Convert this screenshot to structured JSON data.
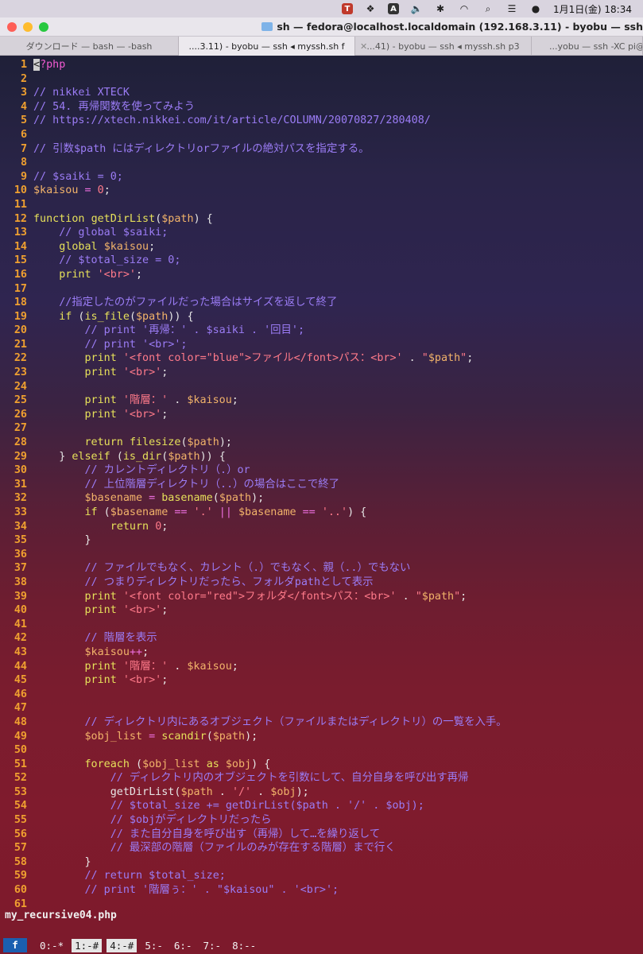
{
  "menubar": {
    "icons": [
      "brand-app-icon",
      "dropbox-icon",
      "input-a-icon",
      "volume-icon",
      "bluetooth-icon",
      "wifi-icon",
      "search-icon",
      "control-center-icon",
      "siri-icon"
    ],
    "input_label": "A",
    "clock": "1月1日(金)  18:34"
  },
  "window": {
    "title": "sh — fedora@localhost.localdomain (192.168.3.11) - byobu — ssh"
  },
  "tabs": [
    {
      "label": "ダウンロード — bash — -bash",
      "active": false
    },
    {
      "label": "....3.11) - byobu — ssh ◂ myssh.sh f",
      "active": true
    },
    {
      "label": "...41) - byobu — ssh ◂ myssh.sh p3",
      "active": false
    },
    {
      "label": "...yobu — ssh -XC pi@19",
      "active": false
    }
  ],
  "code_lines": [
    [
      [
        "cursor",
        "<"
      ],
      [
        "tag",
        "?php"
      ]
    ],
    [],
    [
      [
        "cm",
        "// nikkei XTECK"
      ]
    ],
    [
      [
        "cm",
        "// 54. 再帰関数を使ってみよう"
      ]
    ],
    [
      [
        "cm",
        "// https://xtech.nikkei.com/it/article/COLUMN/20070827/280408/"
      ]
    ],
    [],
    [
      [
        "cm",
        "// 引数$path にはディレクトリorファイルの絶対パスを指定する。"
      ]
    ],
    [],
    [
      [
        "cm",
        "// $saiki = 0;"
      ]
    ],
    [
      [
        "var",
        "$kaisou"
      ],
      [
        "op",
        " = "
      ],
      [
        "num",
        "0"
      ],
      [
        "src",
        ";"
      ]
    ],
    [],
    [
      [
        "kw",
        "function"
      ],
      [
        "src",
        " "
      ],
      [
        "fn",
        "getDirList"
      ],
      [
        "src",
        "("
      ],
      [
        "var",
        "$path"
      ],
      [
        "src",
        ") {"
      ]
    ],
    [
      [
        "src",
        "    "
      ],
      [
        "cm",
        "// global $saiki;"
      ]
    ],
    [
      [
        "src",
        "    "
      ],
      [
        "kw",
        "global"
      ],
      [
        "src",
        " "
      ],
      [
        "var",
        "$kaisou"
      ],
      [
        "src",
        ";"
      ]
    ],
    [
      [
        "src",
        "    "
      ],
      [
        "cm",
        "// $total_size = 0;"
      ]
    ],
    [
      [
        "src",
        "    "
      ],
      [
        "kw",
        "print"
      ],
      [
        "src",
        " "
      ],
      [
        "str",
        "'<br>'"
      ],
      [
        "src",
        ";"
      ]
    ],
    [],
    [
      [
        "src",
        "    "
      ],
      [
        "cm",
        "//指定したのがファイルだった場合はサイズを返して終了"
      ]
    ],
    [
      [
        "src",
        "    "
      ],
      [
        "kw",
        "if"
      ],
      [
        "src",
        " ("
      ],
      [
        "fn",
        "is_file"
      ],
      [
        "src",
        "("
      ],
      [
        "var",
        "$path"
      ],
      [
        "src",
        ")) {"
      ]
    ],
    [
      [
        "src",
        "        "
      ],
      [
        "cm",
        "// print '再帰：' . $saiki . '回目';"
      ]
    ],
    [
      [
        "src",
        "        "
      ],
      [
        "cm",
        "// print '<br>';"
      ]
    ],
    [
      [
        "src",
        "        "
      ],
      [
        "kw",
        "print"
      ],
      [
        "src",
        " "
      ],
      [
        "str",
        "'<font color=\"blue\">ファイル</font>パス：<br>'"
      ],
      [
        "src",
        " . "
      ],
      [
        "str",
        "\""
      ],
      [
        "var",
        "$path"
      ],
      [
        "str",
        "\""
      ],
      [
        "src",
        ";"
      ]
    ],
    [
      [
        "src",
        "        "
      ],
      [
        "kw",
        "print"
      ],
      [
        "src",
        " "
      ],
      [
        "str",
        "'<br>'"
      ],
      [
        "src",
        ";"
      ]
    ],
    [],
    [
      [
        "src",
        "        "
      ],
      [
        "kw",
        "print"
      ],
      [
        "src",
        " "
      ],
      [
        "str",
        "'階層：'"
      ],
      [
        "src",
        " . "
      ],
      [
        "var",
        "$kaisou"
      ],
      [
        "src",
        ";"
      ]
    ],
    [
      [
        "src",
        "        "
      ],
      [
        "kw",
        "print"
      ],
      [
        "src",
        " "
      ],
      [
        "str",
        "'<br>'"
      ],
      [
        "src",
        ";"
      ]
    ],
    [],
    [
      [
        "src",
        "        "
      ],
      [
        "kw",
        "return"
      ],
      [
        "src",
        " "
      ],
      [
        "fn",
        "filesize"
      ],
      [
        "src",
        "("
      ],
      [
        "var",
        "$path"
      ],
      [
        "src",
        ");"
      ]
    ],
    [
      [
        "src",
        "    } "
      ],
      [
        "kw",
        "elseif"
      ],
      [
        "src",
        " ("
      ],
      [
        "fn",
        "is_dir"
      ],
      [
        "src",
        "("
      ],
      [
        "var",
        "$path"
      ],
      [
        "src",
        ")) {"
      ]
    ],
    [
      [
        "src",
        "        "
      ],
      [
        "cm",
        "// カレントディレクトリ（.）or"
      ]
    ],
    [
      [
        "src",
        "        "
      ],
      [
        "cm",
        "// 上位階層ディレクトリ（..）の場合はここで終了"
      ]
    ],
    [
      [
        "src",
        "        "
      ],
      [
        "var",
        "$basename"
      ],
      [
        "op",
        " = "
      ],
      [
        "fn",
        "basename"
      ],
      [
        "src",
        "("
      ],
      [
        "var",
        "$path"
      ],
      [
        "src",
        ");"
      ]
    ],
    [
      [
        "src",
        "        "
      ],
      [
        "kw",
        "if"
      ],
      [
        "src",
        " ("
      ],
      [
        "var",
        "$basename"
      ],
      [
        "op",
        " == "
      ],
      [
        "str",
        "'.'"
      ],
      [
        "op",
        " || "
      ],
      [
        "var",
        "$basename"
      ],
      [
        "op",
        " == "
      ],
      [
        "str",
        "'..'"
      ],
      [
        "src",
        ") {"
      ]
    ],
    [
      [
        "src",
        "            "
      ],
      [
        "kw",
        "return"
      ],
      [
        "src",
        " "
      ],
      [
        "num",
        "0"
      ],
      [
        "src",
        ";"
      ]
    ],
    [
      [
        "src",
        "        }"
      ]
    ],
    [],
    [
      [
        "src",
        "        "
      ],
      [
        "cm",
        "// ファイルでもなく、カレント（.）でもなく、親（..）でもない"
      ]
    ],
    [
      [
        "src",
        "        "
      ],
      [
        "cm",
        "// つまりディレクトリだったら、フォルダpathとして表示"
      ]
    ],
    [
      [
        "src",
        "        "
      ],
      [
        "kw",
        "print"
      ],
      [
        "src",
        " "
      ],
      [
        "str",
        "'<font color=\"red\">フォルダ</font>パス：<br>'"
      ],
      [
        "src",
        " . "
      ],
      [
        "str",
        "\""
      ],
      [
        "var",
        "$path"
      ],
      [
        "str",
        "\""
      ],
      [
        "src",
        ";"
      ]
    ],
    [
      [
        "src",
        "        "
      ],
      [
        "kw",
        "print"
      ],
      [
        "src",
        " "
      ],
      [
        "str",
        "'<br>'"
      ],
      [
        "src",
        ";"
      ]
    ],
    [],
    [
      [
        "src",
        "        "
      ],
      [
        "cm",
        "// 階層を表示"
      ]
    ],
    [
      [
        "src",
        "        "
      ],
      [
        "var",
        "$kaisou"
      ],
      [
        "op",
        "++"
      ],
      [
        "src",
        ";"
      ]
    ],
    [
      [
        "src",
        "        "
      ],
      [
        "kw",
        "print"
      ],
      [
        "src",
        " "
      ],
      [
        "str",
        "'階層：'"
      ],
      [
        "src",
        " . "
      ],
      [
        "var",
        "$kaisou"
      ],
      [
        "src",
        ";"
      ]
    ],
    [
      [
        "src",
        "        "
      ],
      [
        "kw",
        "print"
      ],
      [
        "src",
        " "
      ],
      [
        "str",
        "'<br>'"
      ],
      [
        "src",
        ";"
      ]
    ],
    [],
    [],
    [
      [
        "src",
        "        "
      ],
      [
        "cm",
        "// ディレクトリ内にあるオブジェクト（ファイルまたはディレクトリ）の一覧を入手。"
      ]
    ],
    [
      [
        "src",
        "        "
      ],
      [
        "var",
        "$obj_list"
      ],
      [
        "op",
        " = "
      ],
      [
        "fn",
        "scandir"
      ],
      [
        "src",
        "("
      ],
      [
        "var",
        "$path"
      ],
      [
        "src",
        ");"
      ]
    ],
    [],
    [
      [
        "src",
        "        "
      ],
      [
        "kw",
        "foreach"
      ],
      [
        "src",
        " ("
      ],
      [
        "var",
        "$obj_list"
      ],
      [
        "src",
        " "
      ],
      [
        "kw",
        "as"
      ],
      [
        "src",
        " "
      ],
      [
        "var",
        "$obj"
      ],
      [
        "src",
        ") {"
      ]
    ],
    [
      [
        "src",
        "            "
      ],
      [
        "cm",
        "// ディレクトリ内のオブジェクトを引数にして、自分自身を呼び出す再帰"
      ]
    ],
    [
      [
        "src",
        "            "
      ],
      [
        "src",
        "getDirList("
      ],
      [
        "var",
        "$path"
      ],
      [
        "src",
        " . "
      ],
      [
        "str",
        "'/'"
      ],
      [
        "src",
        " . "
      ],
      [
        "var",
        "$obj"
      ],
      [
        "src",
        ");"
      ]
    ],
    [
      [
        "src",
        "            "
      ],
      [
        "cm",
        "// $total_size += getDirList($path . '/' . $obj);"
      ]
    ],
    [
      [
        "src",
        "            "
      ],
      [
        "cm",
        "// $objがディレクトリだったら"
      ]
    ],
    [
      [
        "src",
        "            "
      ],
      [
        "cm",
        "// また自分自身を呼び出す（再帰）して…を繰り返して"
      ]
    ],
    [
      [
        "src",
        "            "
      ],
      [
        "cm",
        "// 最深部の階層（ファイルのみが存在する階層）まで行く"
      ]
    ],
    [
      [
        "src",
        "        }"
      ]
    ],
    [
      [
        "src",
        "        "
      ],
      [
        "cm",
        "// return $total_size;"
      ]
    ],
    [
      [
        "src",
        "        "
      ],
      [
        "cm",
        "// print '階層ぅ：' . \"$kaisou\" . '<br>';"
      ]
    ],
    []
  ],
  "filename": "my_recursive04.php",
  "statusbar": {
    "session": "f",
    "windows": [
      {
        "label": "0:-*",
        "highlight": false
      },
      {
        "label": "1:-#",
        "highlight": true
      },
      {
        "label": "4:-#",
        "highlight": true
      },
      {
        "label": "5:-",
        "highlight": false
      },
      {
        "label": "6:-",
        "highlight": false
      },
      {
        "label": "7:-",
        "highlight": false
      },
      {
        "label": "8:--",
        "highlight": false
      }
    ]
  }
}
